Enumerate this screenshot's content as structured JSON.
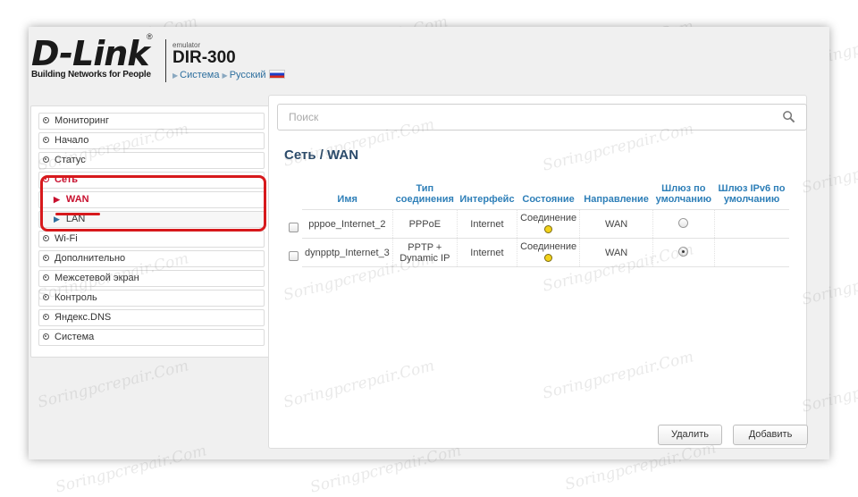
{
  "header": {
    "logo_text": "D-Link",
    "logo_tagline": "Building Networks for People",
    "emulator_label": "emulator",
    "model": "DIR-300",
    "crumb_system": "Система",
    "crumb_language": "Русский"
  },
  "sidebar": {
    "items": [
      {
        "label": "Мониторинг"
      },
      {
        "label": "Начало"
      },
      {
        "label": "Статус"
      },
      {
        "label": "Сеть"
      },
      {
        "label": "Wi-Fi"
      },
      {
        "label": "Дополнительно"
      },
      {
        "label": "Межсетевой экран"
      },
      {
        "label": "Контроль"
      },
      {
        "label": "Яндекс.DNS"
      },
      {
        "label": "Система"
      }
    ],
    "subitems": [
      {
        "label": "WAN"
      },
      {
        "label": "LAN"
      }
    ]
  },
  "search": {
    "placeholder": "Поиск"
  },
  "page": {
    "title": "Сеть /  WAN"
  },
  "table": {
    "headers": {
      "name": "Имя",
      "type": "Тип соединения",
      "interface": "Интерфейс",
      "state": "Состояние",
      "direction": "Направление",
      "gateway": "Шлюз по умолчанию",
      "gateway6": "Шлюз IPv6 по умолчанию"
    },
    "rows": [
      {
        "name": "pppoe_Internet_2",
        "type": "PPPoE",
        "interface": "Internet",
        "state": "Соединение",
        "direction": "WAN",
        "gateway_selected": false
      },
      {
        "name": "dynpptp_Internet_3",
        "type": "PPTP + Dynamic IP",
        "interface": "Internet",
        "state": "Соединение",
        "direction": "WAN",
        "gateway_selected": true
      }
    ]
  },
  "buttons": {
    "delete": "Удалить",
    "add": "Добавить"
  },
  "colors": {
    "accent_red": "#d7191c",
    "header_blue": "#2e7fb8",
    "status_yellow": "#f2d21b"
  },
  "watermark": "Soringpcrepair.Com"
}
